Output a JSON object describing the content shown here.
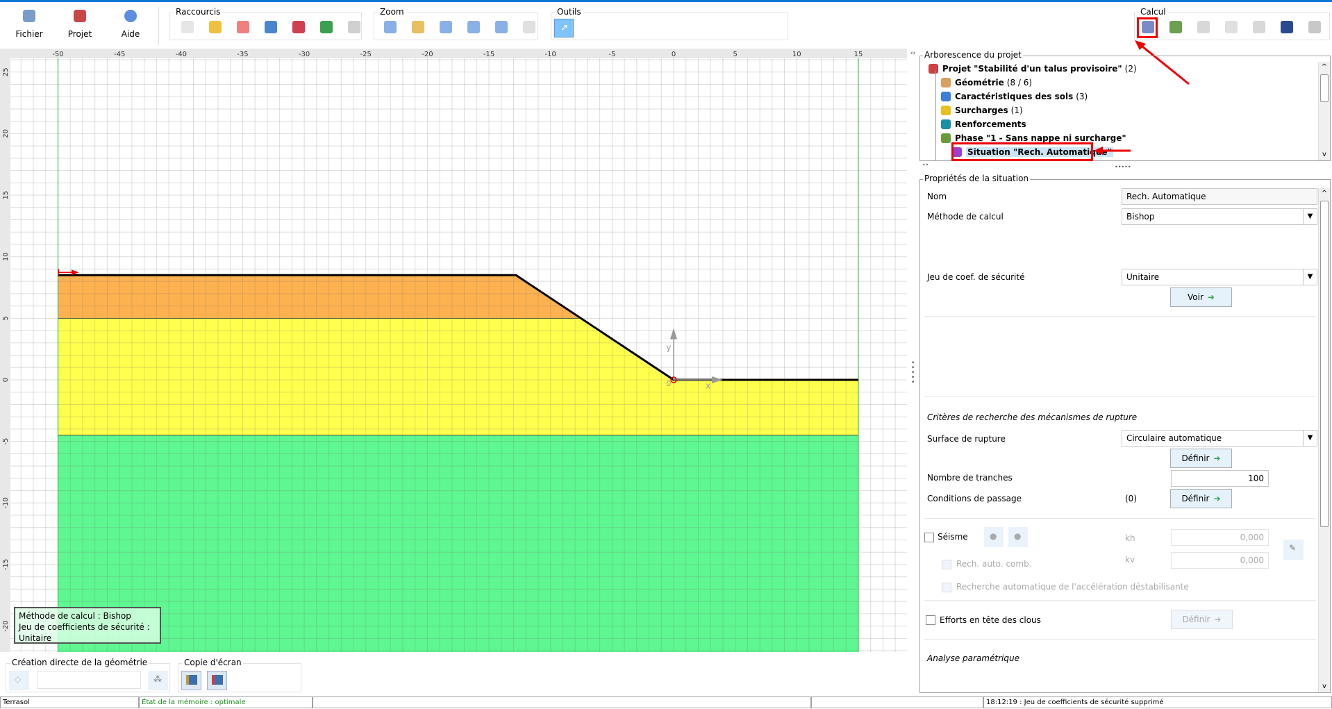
{
  "ribbon": {
    "big_buttons": [
      {
        "label": "Fichier",
        "icon": "computer-icon"
      },
      {
        "label": "Projet",
        "icon": "project-cubes-icon"
      },
      {
        "label": "Aide",
        "icon": "help-icon"
      }
    ],
    "groups": {
      "raccourcis": {
        "label": "Raccourcis",
        "icons": [
          "new-file-icon",
          "open-folder-icon",
          "favorite-heart-icon",
          "save-icon",
          "print-icon",
          "undo-icon",
          "redo-icon"
        ]
      },
      "zoom": {
        "label": "Zoom",
        "icons": [
          "zoom-fit-icon",
          "zoom-lock-icon",
          "zoom-out-icon",
          "zoom-in-icon",
          "zoom-window-icon",
          "zoom-pan-icon"
        ]
      },
      "outils": {
        "label": "Outils",
        "icons": [
          "select-pointer-icon"
        ]
      },
      "calcul": {
        "label": "Calcul",
        "icons": [
          "situation-calc-icon",
          "phase-check-icon",
          "copy-calc-icon",
          "results-graph-icon",
          "slices-icon",
          "seismic-icon",
          "slope-icon"
        ]
      }
    }
  },
  "tree": {
    "title": "Arborescence du projet",
    "items": [
      {
        "name": "Projet \"Stabilité d'un talus provisoire\"",
        "count": "(2)",
        "icon": "project-icon",
        "color": "#d04040"
      },
      {
        "name": "Géométrie",
        "count": "(8 / 6)",
        "icon": "geometry-ruler-icon",
        "color": "#d9a060"
      },
      {
        "name": "Caractéristiques des sols",
        "count": "(3)",
        "icon": "soils-icon",
        "color": "#3c7ed8"
      },
      {
        "name": "Surcharges",
        "count": "(1)",
        "icon": "weight-icon",
        "color": "#e8c020"
      },
      {
        "name": "Renforcements",
        "count": "",
        "icon": "anchor-icon",
        "color": "#1b8fa8"
      },
      {
        "name": "Phase \"1 - Sans nappe ni surcharge\"",
        "count": "",
        "icon": "phase-clock-icon",
        "color": "#6a9a3a"
      },
      {
        "name": "Situation \"Rech. Automatique\"",
        "count": "",
        "icon": "situation-icon",
        "color": "#9a40d0"
      }
    ]
  },
  "props": {
    "title": "Propriétés de la situation",
    "nom_label": "Nom",
    "nom_value": "Rech. Automatique",
    "methode_label": "Méthode de calcul",
    "methode_value": "Bishop",
    "jeu_label": "Jeu de coef. de sécurité",
    "jeu_value": "Unitaire",
    "voir": "Voir",
    "criteres": "Critères de recherche des mécanismes de rupture",
    "surface_label": "Surface de rupture",
    "surface_value": "Circulaire automatique",
    "definir": "Définir",
    "tranches_label": "Nombre de tranches",
    "tranches_value": "100",
    "conditions_label": "Conditions de passage",
    "conditions_count": "(0)",
    "seisme_label": "Séisme",
    "kh_label": "kh",
    "kh_value": "0,000",
    "kv_label": "kv",
    "kv_value": "0,000",
    "rech_auto": "Rech. auto. comb.",
    "recherche_acc": "Recherche automatique de l'accélération déstabilisante",
    "efforts_label": "Efforts en tête des clous",
    "analyse": "Analyse paramétrique"
  },
  "canvas": {
    "legend": [
      "Méthode de calcul : Bishop",
      "Jeu de coefficients de sécurité : Unitaire"
    ],
    "x_ticks": [
      -50,
      -45,
      -40,
      -35,
      -30,
      -25,
      -20,
      -15,
      -10,
      -5,
      0,
      5,
      10,
      15
    ],
    "y_ticks": [
      25,
      20,
      15,
      10,
      5,
      0,
      -5,
      -10,
      -15,
      -20
    ],
    "axis_x": "x",
    "axis_y": "y",
    "origin": "0",
    "layers": [
      {
        "color": "#fdb14f",
        "points": [
          [
            -50,
            8.5
          ],
          [
            -12.8,
            8.5
          ],
          [
            -7.5,
            5
          ],
          [
            -50,
            5
          ]
        ]
      },
      {
        "color": "#ffff4d",
        "points": [
          [
            -50,
            5
          ],
          [
            -7.5,
            5
          ],
          [
            0,
            0
          ],
          [
            15,
            0
          ],
          [
            15,
            -4.5
          ],
          [
            -50,
            -4.5
          ]
        ]
      },
      {
        "color": "#5ef791",
        "points": [
          [
            -50,
            -4.5
          ],
          [
            15,
            -4.5
          ],
          [
            15,
            -23
          ],
          [
            -50,
            -23
          ]
        ]
      }
    ],
    "ground": [
      [
        -50,
        8.5
      ],
      [
        -12.8,
        8.5
      ],
      [
        0,
        0
      ],
      [
        15,
        0
      ]
    ],
    "limits_x": [
      -50,
      15
    ]
  },
  "bottom": {
    "creation": "Création directe de la géométrie",
    "copie": "Copie d'écran"
  },
  "status": {
    "app": "Terrasol",
    "memory": "État de la mémoire : optimale",
    "message": "18:12:19 : Jeu de coefficients de sécurité supprimé"
  }
}
